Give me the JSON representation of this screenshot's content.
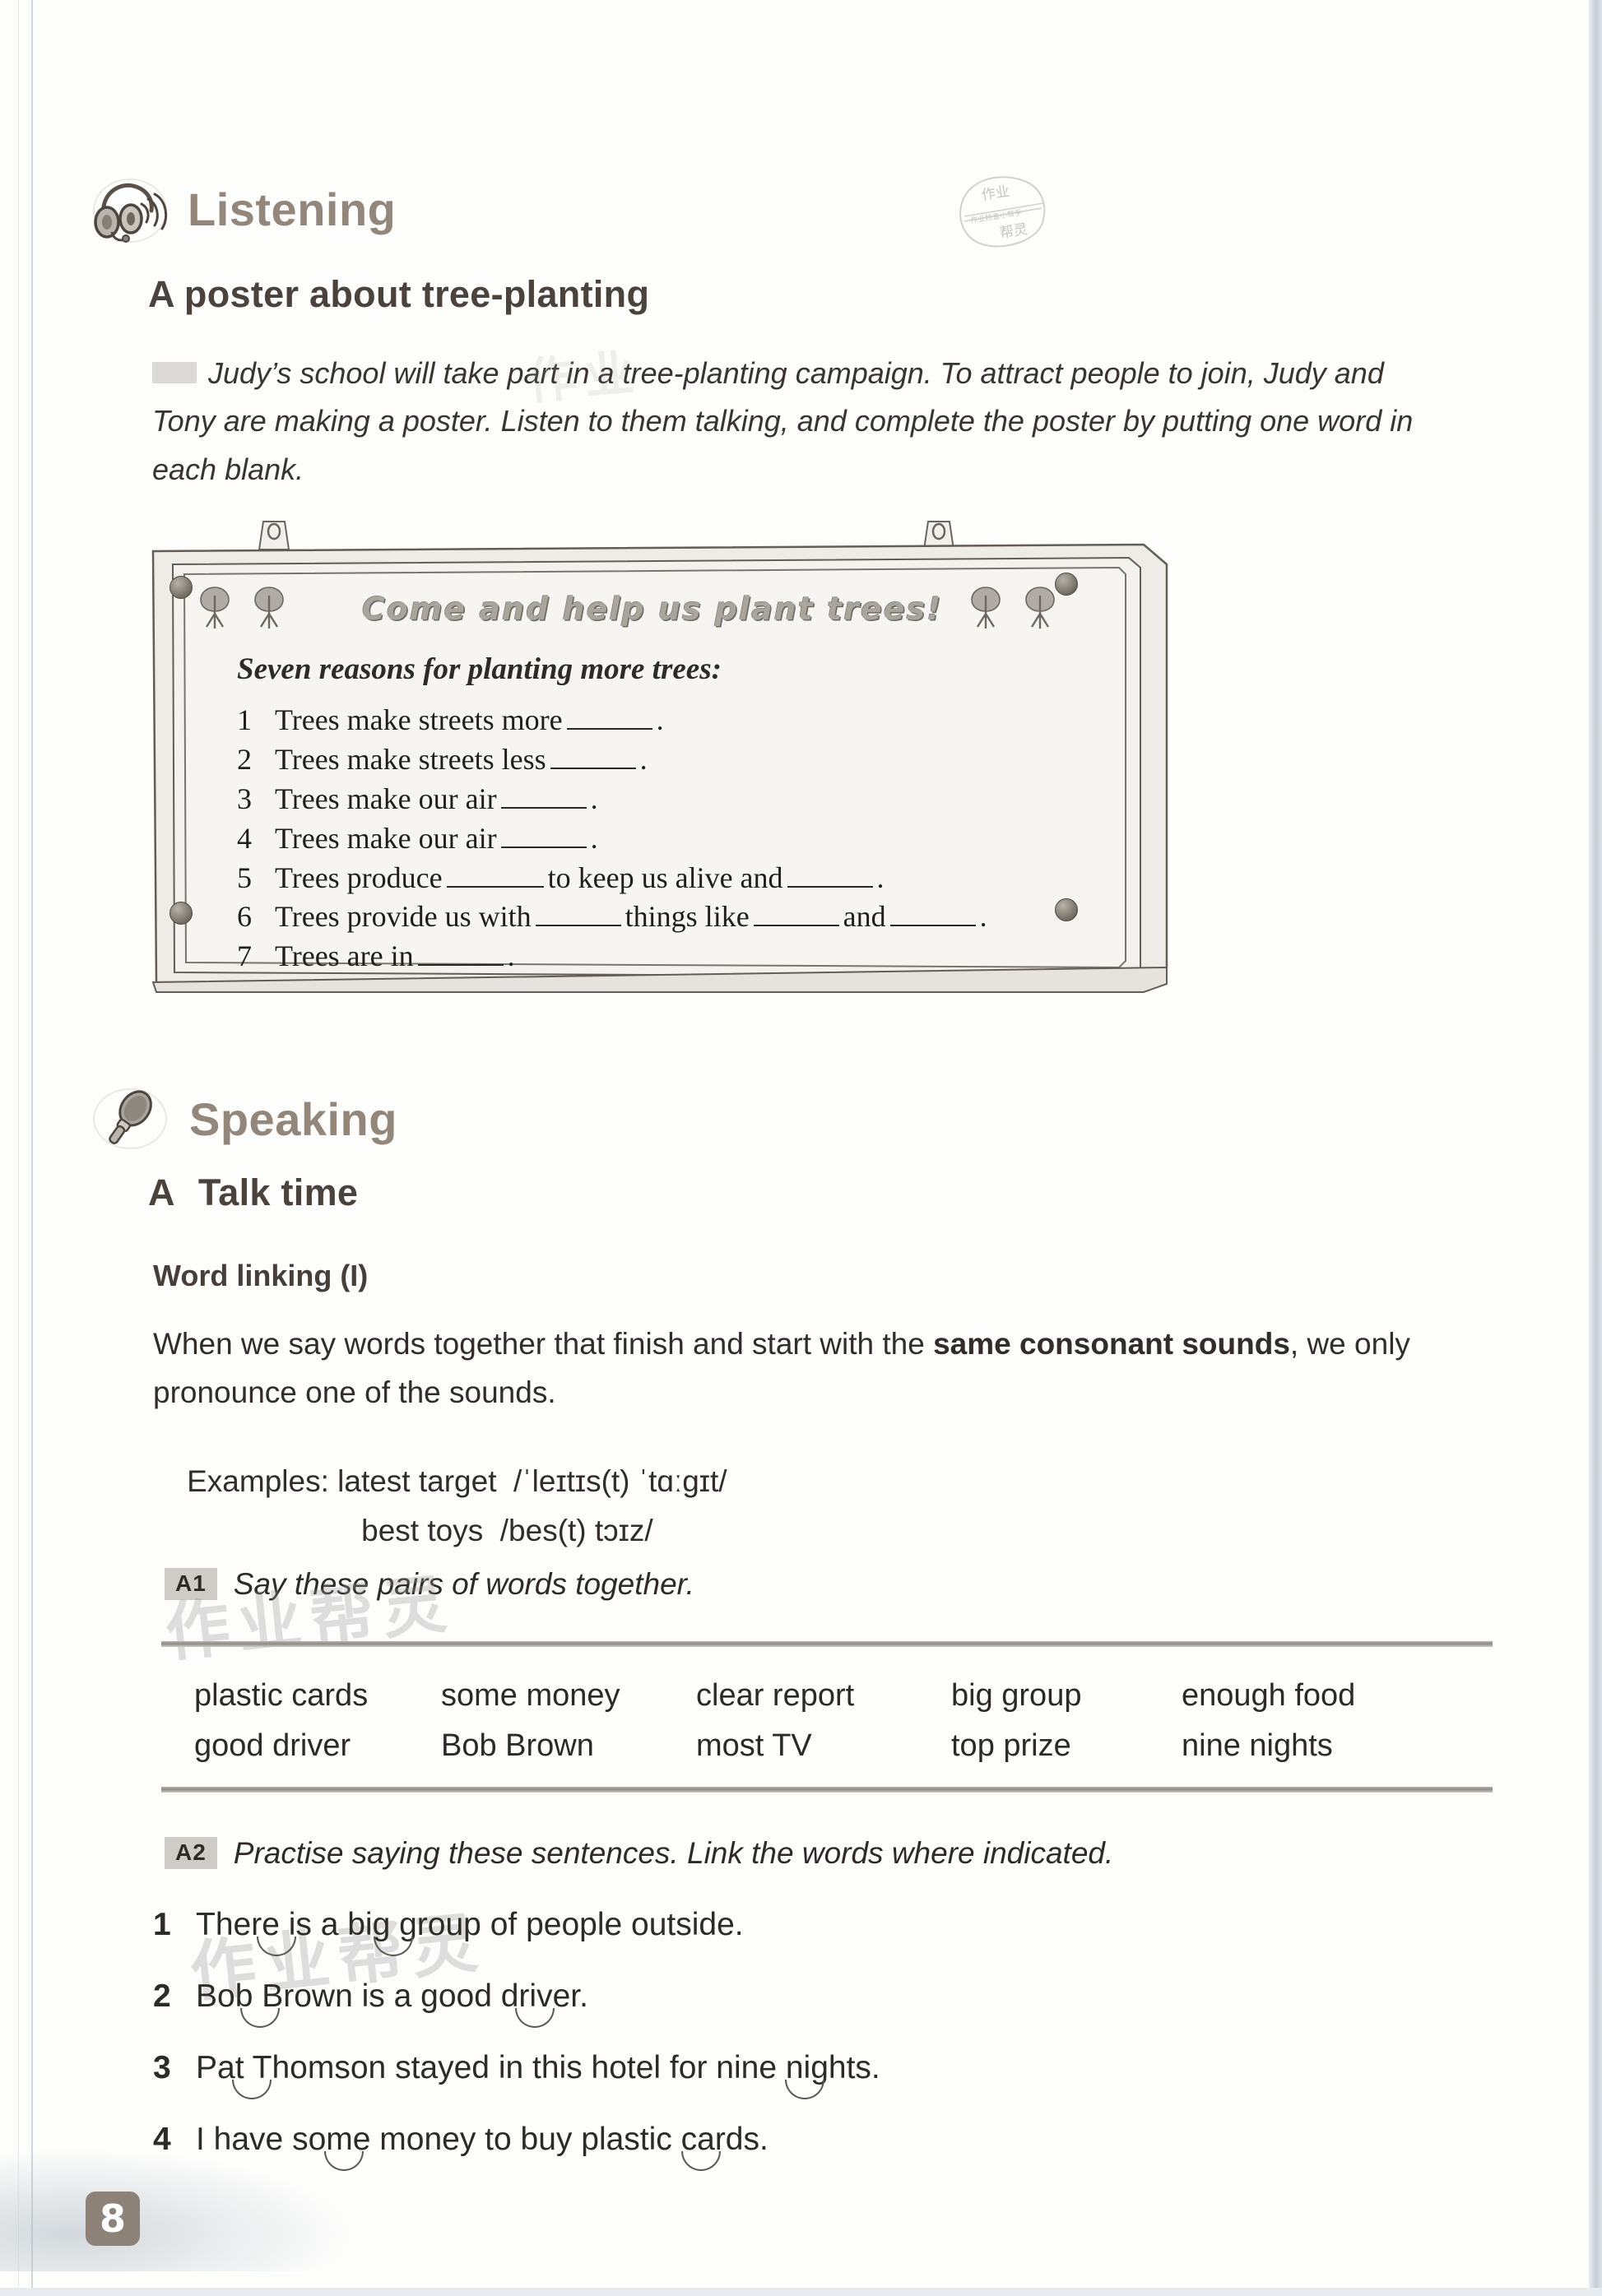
{
  "page": {
    "number": "8"
  },
  "watermark": {
    "stamp_top": "作业",
    "stamp_mid": "作业检查小帮手",
    "stamp_bottom": "帮灵",
    "overlay_1": "作业帮灵",
    "overlay_2": "作业帮灵",
    "overlay_3": "作业"
  },
  "listening": {
    "section_label": "Listening",
    "icon": "headphones-icon",
    "heading": "A poster about tree-planting",
    "intro": "Judy’s school will take part in a tree-planting campaign. To attract people to join, Judy and Tony are making a poster. Listen to them talking, and complete the poster by putting one word in each blank.",
    "poster": {
      "title": "Come and help us plant trees!",
      "subtitle": "Seven reasons for planting more trees:",
      "items": [
        {
          "num": "1",
          "before": "Trees make streets more",
          "mid": "",
          "after": ".",
          "blanks": 1
        },
        {
          "num": "2",
          "before": "Trees make streets less",
          "mid": "",
          "after": ".",
          "blanks": 1
        },
        {
          "num": "3",
          "before": "Trees make our air",
          "mid": "",
          "after": ".",
          "blanks": 1
        },
        {
          "num": "4",
          "before": "Trees make our air",
          "mid": "",
          "after": ".",
          "blanks": 1
        },
        {
          "num": "5",
          "before": "Trees produce",
          "mid": "to keep us alive and",
          "after": ".",
          "blanks": 2
        },
        {
          "num": "6",
          "before": "Trees provide us with",
          "mid": "things like",
          "after": "and",
          "blanks": 3
        },
        {
          "num": "7",
          "before": "Trees are in",
          "mid": "",
          "after": ".",
          "blanks": 1
        }
      ]
    }
  },
  "speaking": {
    "section_label": "Speaking",
    "icon": "microphone-icon",
    "part_letter": "A",
    "part_title": "Talk time",
    "subheading": "Word linking (I)",
    "rule_text_1": "When we say words together that finish and start with the ",
    "rule_text_bold": "same consonant sounds",
    "rule_text_2": ", we only pronounce one of the sounds.",
    "examples_label": "Examples:",
    "example_1_words": "latest target",
    "example_1_ipa": "/ˈleɪtɪs(t) ˈtɑːgɪt/",
    "example_2_words": "best toys",
    "example_2_ipa": "/bes(t) tɔɪz/",
    "a1": {
      "badge": "A1",
      "instruction": "Say these pairs of words together.",
      "pairs_row_1": [
        "plastic cards",
        "some money",
        "clear report",
        "big group",
        "enough food"
      ],
      "pairs_row_2": [
        "good driver",
        "Bob Brown",
        "most TV",
        "top prize",
        "nine nights"
      ]
    },
    "a2": {
      "badge": "A2",
      "instruction": "Practise saying these sentences. Link the words where indicated.",
      "sentences": [
        {
          "num": "1",
          "text": "There is a big group of people outside."
        },
        {
          "num": "2",
          "text": "Bob Brown is a good driver."
        },
        {
          "num": "3",
          "text": "Pat Thomson stayed in this hotel for nine nights."
        },
        {
          "num": "4",
          "text": "I have some money to buy plastic cards."
        }
      ]
    }
  },
  "colors": {
    "section_heading": "#93877b",
    "body_text": "#322d29",
    "badge_bg": "#cfccc7",
    "pagenum_bg": "#8d8278"
  }
}
